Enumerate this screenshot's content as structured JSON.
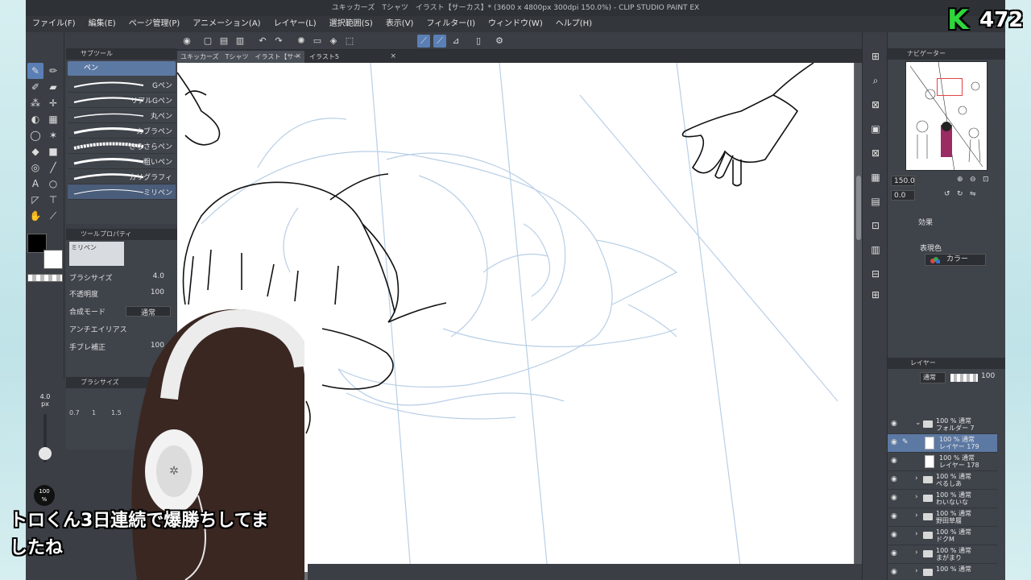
{
  "window": {
    "title": "ユキッカーズ　Tシャツ　イラスト【サーカス】* (3600 x 4800px 300dpi 150.0%)  - CLIP STUDIO PAINT EX"
  },
  "menu": [
    "ファイル(F)",
    "編集(E)",
    "ページ管理(P)",
    "アニメーション(A)",
    "レイヤー(L)",
    "選択範囲(S)",
    "表示(V)",
    "フィルター(I)",
    "ウィンドウ(W)",
    "ヘルプ(H)"
  ],
  "tabs": [
    {
      "label": "ユキッカーズ　Tシャツ　イラスト【サーカス】*"
    },
    {
      "label": "イラスト5"
    }
  ],
  "subtool": {
    "panel_title": "サブツール",
    "group": "ペン",
    "brushes": [
      "Gペン",
      "リアルGペン",
      "丸ペン",
      "カブラペン",
      "さらさらペン",
      "粗いペン",
      "カリグラフィ",
      "ミリペン"
    ]
  },
  "tool_property": {
    "panel_title": "ツールプロパティ",
    "current": "ミリペン",
    "brush_size_label": "ブラシサイズ",
    "brush_size": "4.0",
    "opacity_label": "不透明度",
    "opacity": "100",
    "blend_label": "合成モード",
    "blend_value": "通常",
    "antialias_label": "アンチエイリアス",
    "stabilizer_label": "手ブレ補正",
    "stabilizer": "100"
  },
  "brush_size_panel": {
    "title": "ブラシサイズ",
    "presets": [
      "0.7",
      "1",
      "1.5"
    ]
  },
  "size_readout": {
    "value": "4.0",
    "unit": "px"
  },
  "opacity_badge": {
    "value": "100",
    "unit": "%"
  },
  "navigator": {
    "title": "ナビゲーター",
    "zoom": "150.0",
    "rotate": "0.0"
  },
  "layer_property": {
    "effect_label": "効果",
    "expression_label": "表現色",
    "expression_value": "カラー"
  },
  "layers": {
    "title": "レイヤー",
    "blend": "通常",
    "opacity": "100",
    "rows": [
      {
        "line1": "100 % 通常",
        "line2": "フォルダー 7",
        "kind": "folder",
        "open": true
      },
      {
        "line1": "100 % 通常",
        "line2": "レイヤー 179",
        "kind": "layer",
        "selected": true
      },
      {
        "line1": "100 % 通常",
        "line2": "レイヤー 178",
        "kind": "layer"
      },
      {
        "line1": "100 % 通常",
        "line2": "ぺるしあ",
        "kind": "folder"
      },
      {
        "line1": "100 % 通常",
        "line2": "わいないな",
        "kind": "folder"
      },
      {
        "line1": "100 % 通常",
        "line2": "野田草履",
        "kind": "folder"
      },
      {
        "line1": "100 % 通常",
        "line2": "ドクM",
        "kind": "folder"
      },
      {
        "line1": "100 % 通常",
        "line2": "まがまり",
        "kind": "folder"
      },
      {
        "line1": "100 % 通常",
        "line2": "",
        "kind": "folder"
      }
    ]
  },
  "overlay": {
    "caption_line1": "トロくん3日連続で爆勝ちしてま",
    "caption_line2": "したね",
    "badge_letter": "K",
    "badge_number": "472",
    "badge_color": "#2fd63a"
  },
  "colors": {
    "accent": "#5a7fb5",
    "selected_layer": "#5c79a3",
    "main_color": "#000000",
    "sub_color": "#ffffff"
  }
}
